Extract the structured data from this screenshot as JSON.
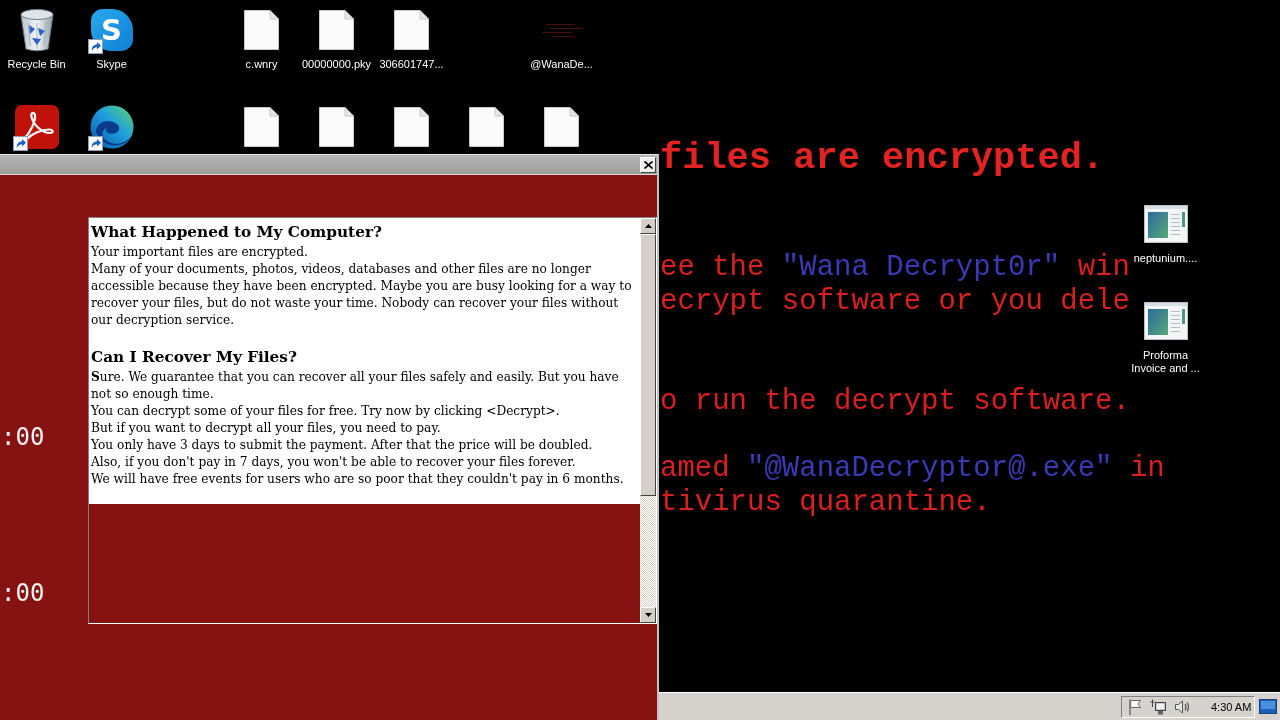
{
  "desktop_icons": [
    {
      "label": "Recycle Bin",
      "kind": "recycle-bin",
      "shortcut": false
    },
    {
      "label": "Skype",
      "kind": "skype",
      "logo": "S",
      "shortcut": true
    },
    {
      "label": "c.wnry",
      "kind": "file",
      "shortcut": false
    },
    {
      "label": "00000000.pky",
      "kind": "file",
      "shortcut": false
    },
    {
      "label": "306601747...",
      "kind": "file",
      "shortcut": false
    },
    {
      "label": "@WanaDe...",
      "kind": "dark-program",
      "shortcut": false
    },
    {
      "kind": "pdf-app",
      "shortcut": true
    },
    {
      "kind": "browser",
      "shortcut": true
    },
    {
      "kind": "file",
      "shortcut": false
    },
    {
      "kind": "file",
      "shortcut": false
    },
    {
      "kind": "file",
      "shortcut": false
    },
    {
      "kind": "file",
      "shortcut": false
    },
    {
      "kind": "file",
      "shortcut": false
    },
    {
      "label": "neptunium....",
      "kind": "window-app",
      "shortcut": false
    },
    {
      "label": "Proforma Invoice and ...",
      "kind": "window-app",
      "shortcut": false
    }
  ],
  "wallpaper_text": [
    {
      "kind": "title",
      "segments": [
        {
          "text": "files are encrypted.",
          "color": "#e32222"
        }
      ]
    },
    {
      "kind": "line",
      "segments": [
        {
          "text": "ee the ",
          "color": "#d82020"
        },
        {
          "text": "\"Wana Decrypt0r\"",
          "color": "#3a3ab4"
        },
        {
          "text": " win",
          "color": "#d82020"
        }
      ]
    },
    {
      "kind": "line",
      "segments": [
        {
          "text": "ecrypt software or you dele",
          "color": "#d82020"
        }
      ]
    },
    {
      "kind": "line",
      "segments": [
        {
          "text": "o run the decrypt software.",
          "color": "#d82020"
        }
      ]
    },
    {
      "kind": "line",
      "segments": [
        {
          "text": "amed ",
          "color": "#d82020"
        },
        {
          "text": "\"@WanaDecryptor@.exe\"",
          "color": "#3a3ab4"
        },
        {
          "text": " in",
          "color": "#d82020"
        }
      ]
    },
    {
      "kind": "line",
      "segments": [
        {
          "text": "tivirus quarantine.",
          "color": "#d82020"
        }
      ]
    }
  ],
  "window": {
    "timers": [
      ":00",
      ":00"
    ],
    "message": [
      {
        "heading": "What Happened to My Computer?",
        "paragraphs": [
          "Your important files are encrypted.",
          "Many of your documents, photos, videos, databases and other files are no longer accessible because they have been encrypted. Maybe you are busy looking for a way to recover your files, but do not waste your time. Nobody can recover your files without our decryption service."
        ]
      },
      {
        "heading": "Can I Recover My Files?",
        "paragraphs": [
          "**S**ure. We guarantee that you can recover all your files safely and easily. But you have not so enough time.",
          "You can decrypt some of your files for free. Try now by clicking <Decrypt>.",
          "But if you want to decrypt all your files, you need to pay.",
          "You only have 3 days to submit the payment. After that the price will be doubled.",
          "Also, if you don't pay in 7 days, you won't be able to recover your files forever.",
          "We will have free events for users who are so poor that they couldn't pay in 6 months."
        ]
      }
    ]
  },
  "taskbar": {
    "clock": "4:30 AM"
  }
}
